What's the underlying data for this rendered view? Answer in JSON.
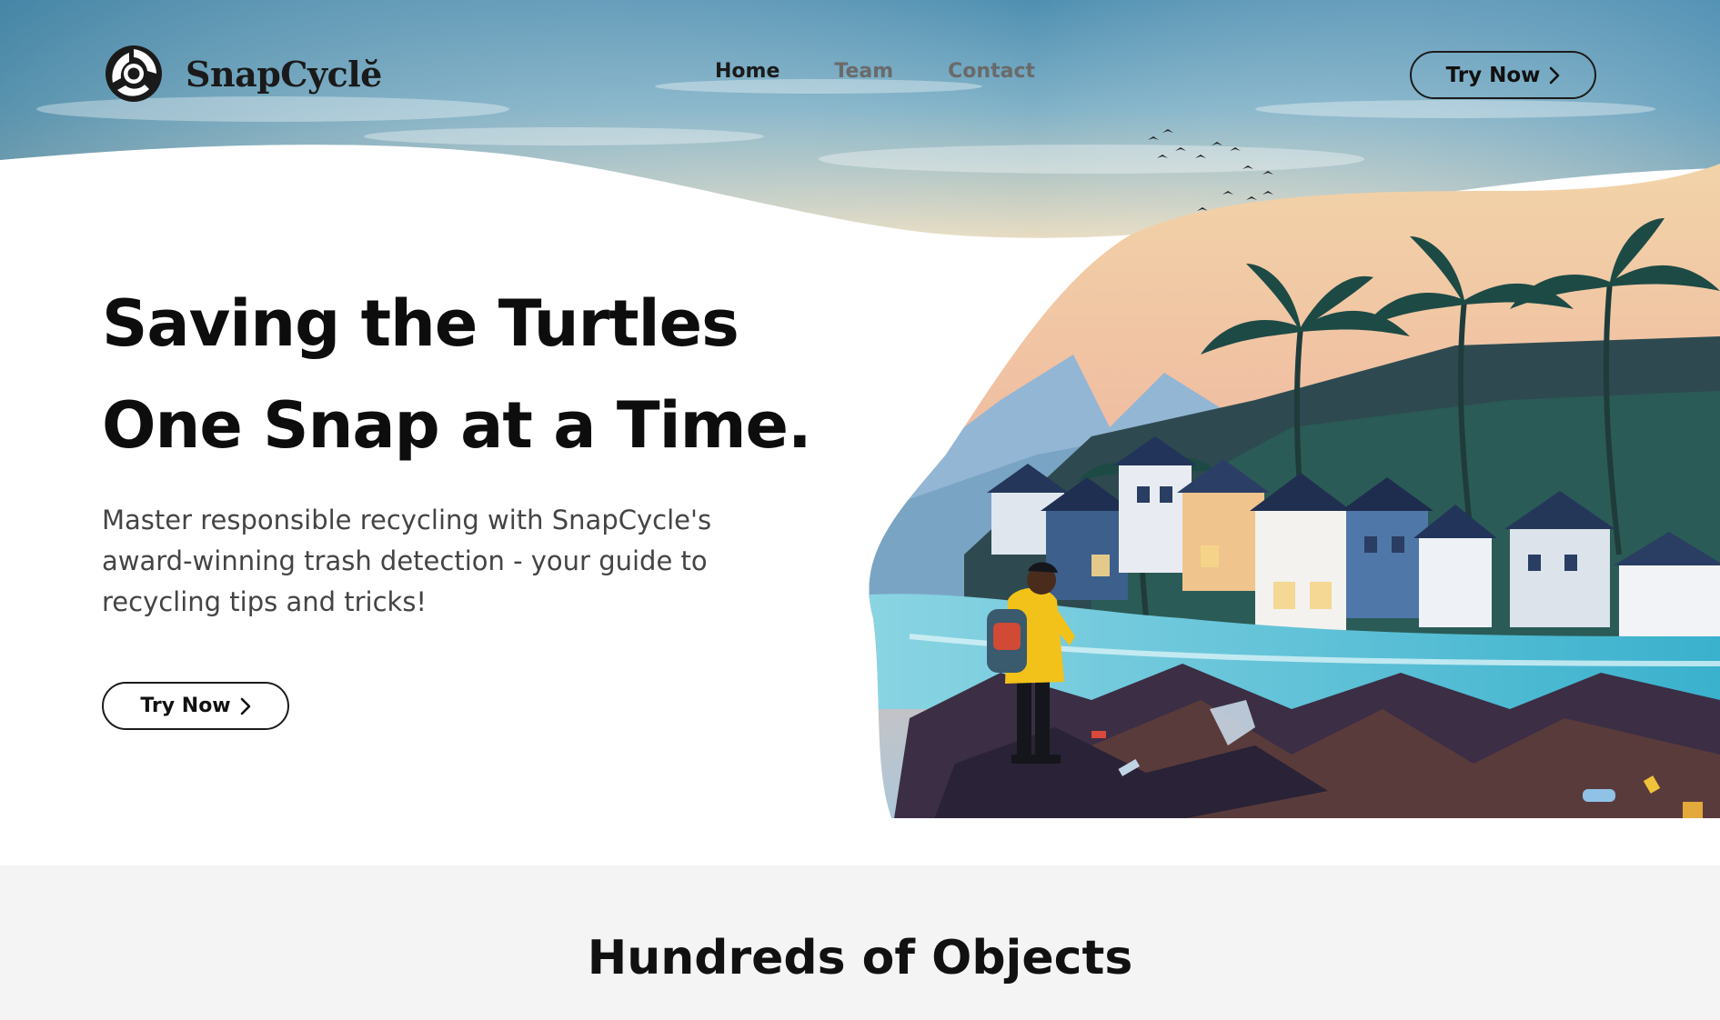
{
  "brand": {
    "name": "SnapCyclĕ"
  },
  "nav": {
    "items": [
      {
        "label": "Home",
        "active": true
      },
      {
        "label": "Team",
        "active": false
      },
      {
        "label": "Contact",
        "active": false
      }
    ]
  },
  "header_cta": {
    "label": "Try Now",
    "icon": "chevron-right-icon"
  },
  "hero": {
    "title_line1": "Saving the Turtles",
    "title_line2": "One Snap at a Time.",
    "subtitle": "Master responsible recycling with SnapCycle's award-winning trash detection - your guide to recycling tips and tricks!",
    "cta_label": "Try Now"
  },
  "section": {
    "title": "Hundreds of Objects"
  },
  "colors": {
    "text": "#111111",
    "nav_inactive": "#6a6a6a",
    "section_bg": "#f4f4f4",
    "sky": "#5f9ab8",
    "accent_jacket": "#f2c21a"
  }
}
